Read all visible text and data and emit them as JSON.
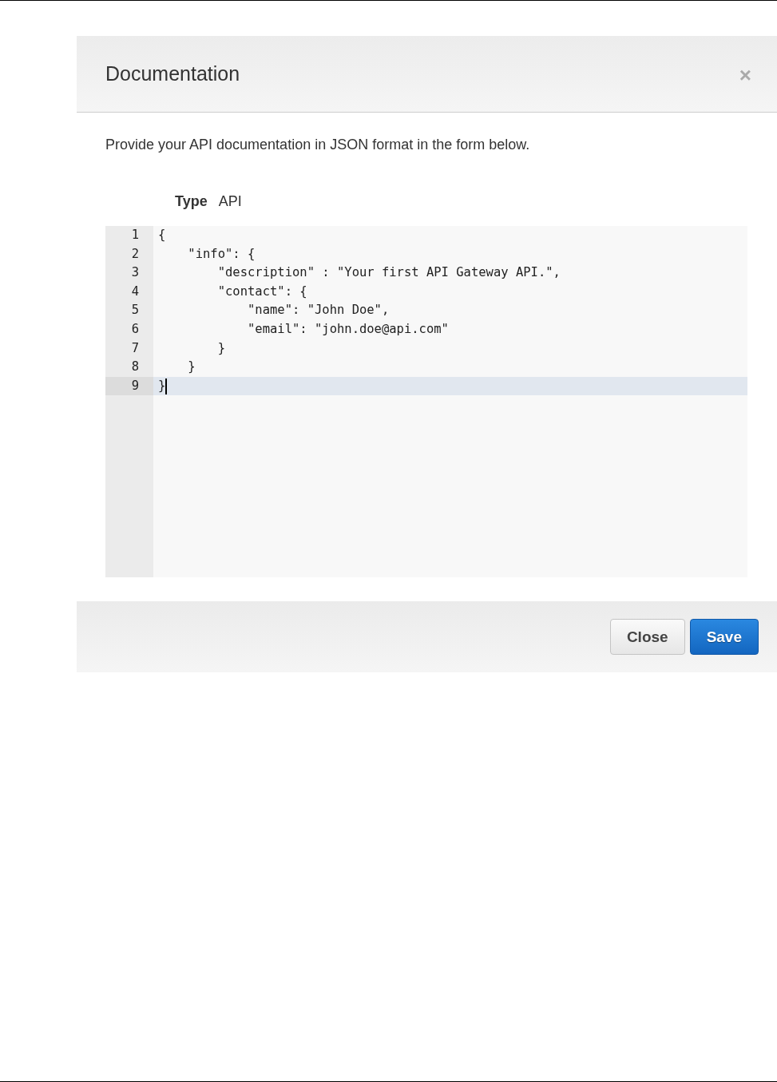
{
  "dialog": {
    "title": "Documentation",
    "close_icon": "×",
    "intro": "Provide your API documentation in JSON format in the form below.",
    "type": {
      "label": "Type",
      "value": "API"
    },
    "editor": {
      "lines": [
        {
          "number": "1",
          "text": "{",
          "current": false
        },
        {
          "number": "2",
          "text": "    \"info\": {",
          "current": false
        },
        {
          "number": "3",
          "text": "        \"description\" : \"Your first API Gateway API.\",",
          "current": false
        },
        {
          "number": "4",
          "text": "        \"contact\": {",
          "current": false
        },
        {
          "number": "5",
          "text": "            \"name\": \"John Doe\",",
          "current": false
        },
        {
          "number": "6",
          "text": "            \"email\": \"john.doe@api.com\"",
          "current": false
        },
        {
          "number": "7",
          "text": "        }",
          "current": false
        },
        {
          "number": "8",
          "text": "    }",
          "current": false
        },
        {
          "number": "9",
          "text": "}",
          "current": true
        }
      ]
    },
    "buttons": [
      {
        "label": "Close",
        "kind": "secondary"
      },
      {
        "label": "Save",
        "kind": "primary"
      }
    ]
  }
}
